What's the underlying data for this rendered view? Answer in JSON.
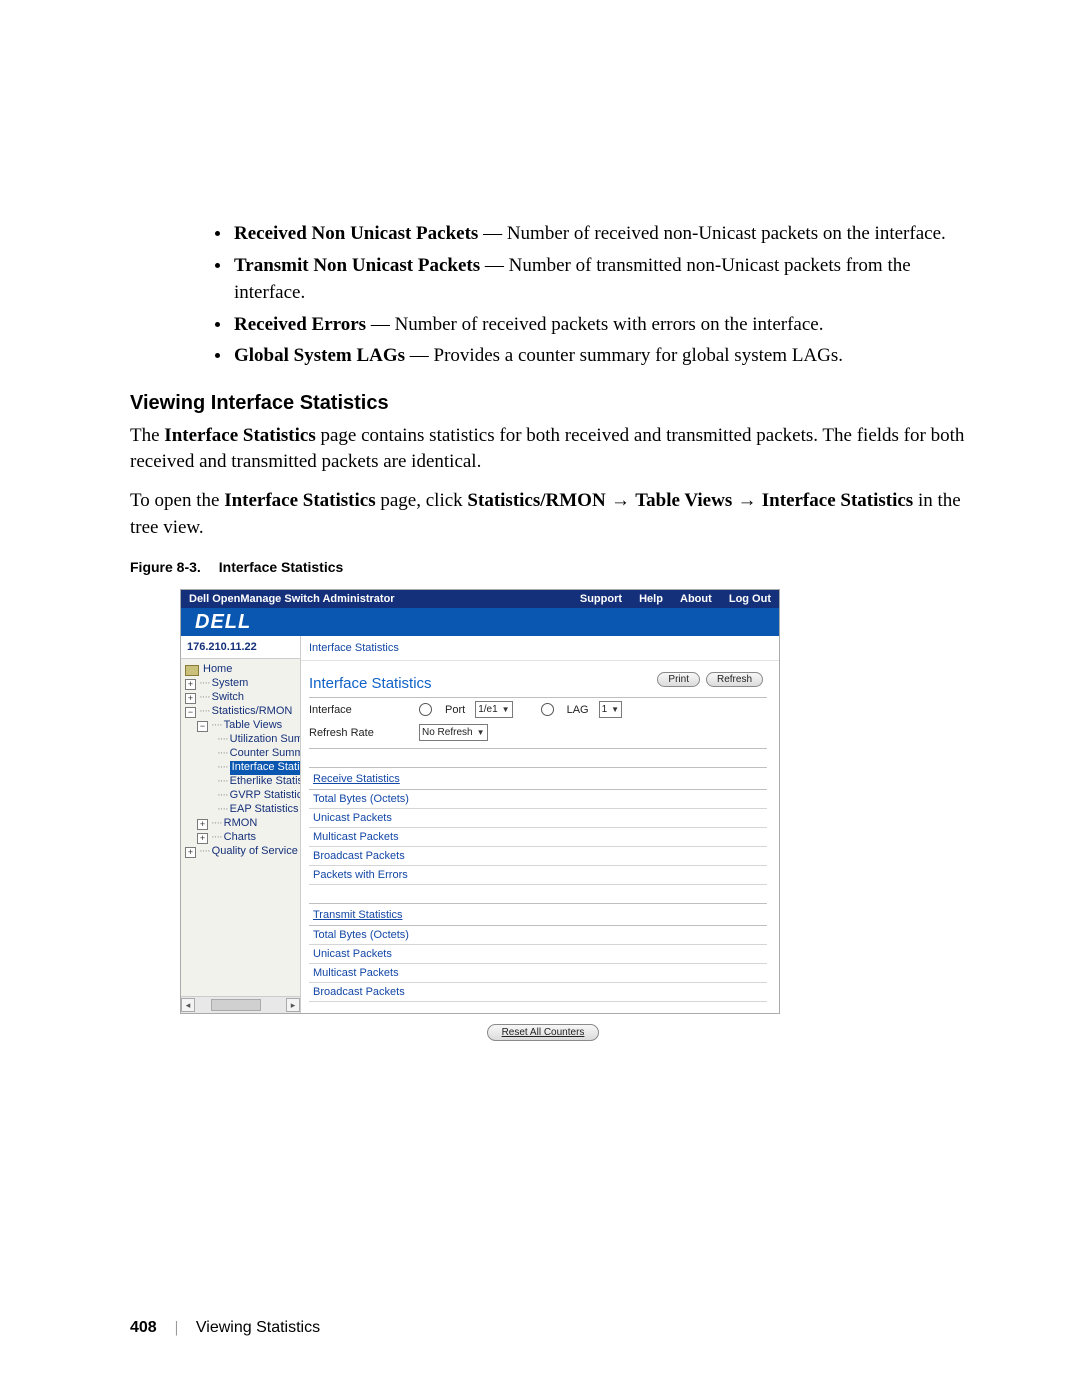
{
  "bullets": [
    {
      "term": "Received Non Unicast Packets",
      "desc": "Number of received non-Unicast packets on the interface."
    },
    {
      "term": "Transmit Non Unicast Packets",
      "desc": "Number of transmitted non-Unicast packets from the interface."
    },
    {
      "term": "Received Errors",
      "desc": "Number of received packets with errors on the interface."
    },
    {
      "term": "Global System LAGs",
      "desc": "Provides a counter summary for global system LAGs."
    }
  ],
  "section_heading": "Viewing Interface Statistics",
  "para1_a": "The ",
  "para1_bold": "Interface Statistics",
  "para1_b": " page contains statistics for both received and transmitted packets. The fields for both received and transmitted packets are identical.",
  "para2_a": "To open the ",
  "para2_b1": "Interface Statistics",
  "para2_b": " page, click ",
  "para2_c1": "Statistics/RMON",
  "para2_c2": "Table Views",
  "para2_c3": "Interface Statistics",
  "para2_d": " in the tree view.",
  "fig_label": "Figure 8-3.",
  "fig_title": "Interface Statistics",
  "shot": {
    "titlebar": "Dell OpenManage Switch Administrator",
    "nav": [
      "Support",
      "Help",
      "About",
      "Log Out"
    ],
    "brand": "DELL",
    "ip": "176.210.11.22",
    "tree": {
      "home": "Home",
      "system": "System",
      "switch": "Switch",
      "stats": "Statistics/RMON",
      "table": "Table Views",
      "util": "Utilization Summ",
      "counter": "Counter Summar",
      "ifstat": "Interface Statist",
      "ether": "Etherlike Statistic",
      "gvrp": "GVRP Statistics",
      "eap": "EAP Statistics",
      "rmon": "RMON",
      "charts": "Charts",
      "qos": "Quality of Service"
    },
    "crumb": "Interface Statistics",
    "page_title": "Interface Statistics",
    "buttons": {
      "print": "Print",
      "refresh": "Refresh"
    },
    "form": {
      "iface": "Interface",
      "port": "Port",
      "port_v": "1/e1",
      "lag": "LAG",
      "lag_v": "1",
      "rate": "Refresh Rate",
      "rate_v": "No Refresh"
    },
    "recv": {
      "head": "Receive Statistics",
      "rows": [
        "Total Bytes (Octets)",
        "Unicast Packets",
        "Multicast Packets",
        "Broadcast Packets",
        "Packets with Errors"
      ]
    },
    "tx": {
      "head": "Transmit Statistics",
      "rows": [
        "Total Bytes (Octets)",
        "Unicast Packets",
        "Multicast Packets",
        "Broadcast Packets"
      ]
    },
    "reset": "Reset All Counters"
  },
  "footer": {
    "page": "408",
    "div": "|",
    "title": "Viewing Statistics"
  }
}
